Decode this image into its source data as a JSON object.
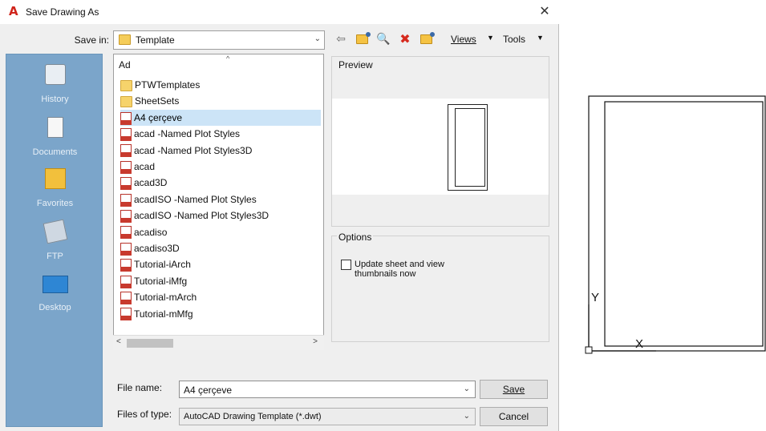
{
  "window": {
    "title": "Save Drawing As",
    "close_glyph": "✕",
    "app_icon_glyph": "A"
  },
  "save_in": {
    "label": "Save in:",
    "value": "Template",
    "arrow": "⌄"
  },
  "toolbar": {
    "back_glyph": "⇦",
    "search_glyph": "🔍",
    "delete_glyph": "✖",
    "views_label": "Views",
    "tools_label": "Tools",
    "dropdown_glyph": "▼"
  },
  "places": {
    "items": [
      {
        "label": "History",
        "icon": "history-icon"
      },
      {
        "label": "Documents",
        "icon": "documents-icon"
      },
      {
        "label": "Favorites",
        "icon": "favorites-icon"
      },
      {
        "label": "FTP",
        "icon": "ftp-icon"
      },
      {
        "label": "Desktop",
        "icon": "desktop-icon"
      }
    ]
  },
  "filelist": {
    "column_header": "Ad",
    "sort_glyph": "^",
    "items": [
      {
        "name": "PTWTemplates",
        "type": "folder"
      },
      {
        "name": "SheetSets",
        "type": "folder"
      },
      {
        "name": "A4 çerçeve",
        "type": "dwt",
        "selected": true
      },
      {
        "name": "acad -Named Plot Styles",
        "type": "dwt"
      },
      {
        "name": "acad -Named Plot Styles3D",
        "type": "dwt"
      },
      {
        "name": "acad",
        "type": "dwt"
      },
      {
        "name": "acad3D",
        "type": "dwt"
      },
      {
        "name": "acadISO -Named Plot Styles",
        "type": "dwt"
      },
      {
        "name": "acadISO -Named Plot Styles3D",
        "type": "dwt"
      },
      {
        "name": "acadiso",
        "type": "dwt"
      },
      {
        "name": "acadiso3D",
        "type": "dwt"
      },
      {
        "name": "Tutorial-iArch",
        "type": "dwt"
      },
      {
        "name": "Tutorial-iMfg",
        "type": "dwt"
      },
      {
        "name": "Tutorial-mArch",
        "type": "dwt"
      },
      {
        "name": "Tutorial-mMfg",
        "type": "dwt"
      }
    ],
    "scroll_left": "<",
    "scroll_right": ">"
  },
  "preview": {
    "label": "Preview"
  },
  "options": {
    "label": "Options",
    "update_thumbnails": "Update sheet and view thumbnails now",
    "checked": false
  },
  "file_name": {
    "label": "File name:",
    "value": "A4 çerçeve",
    "arrow": "⌄"
  },
  "file_type": {
    "label": "Files of type:",
    "value": "AutoCAD Drawing Template (*.dwt)",
    "arrow": "⌄"
  },
  "buttons": {
    "save": "Save",
    "cancel": "Cancel"
  },
  "drawing": {
    "y_axis_label": "Y",
    "x_axis_label": "X"
  }
}
